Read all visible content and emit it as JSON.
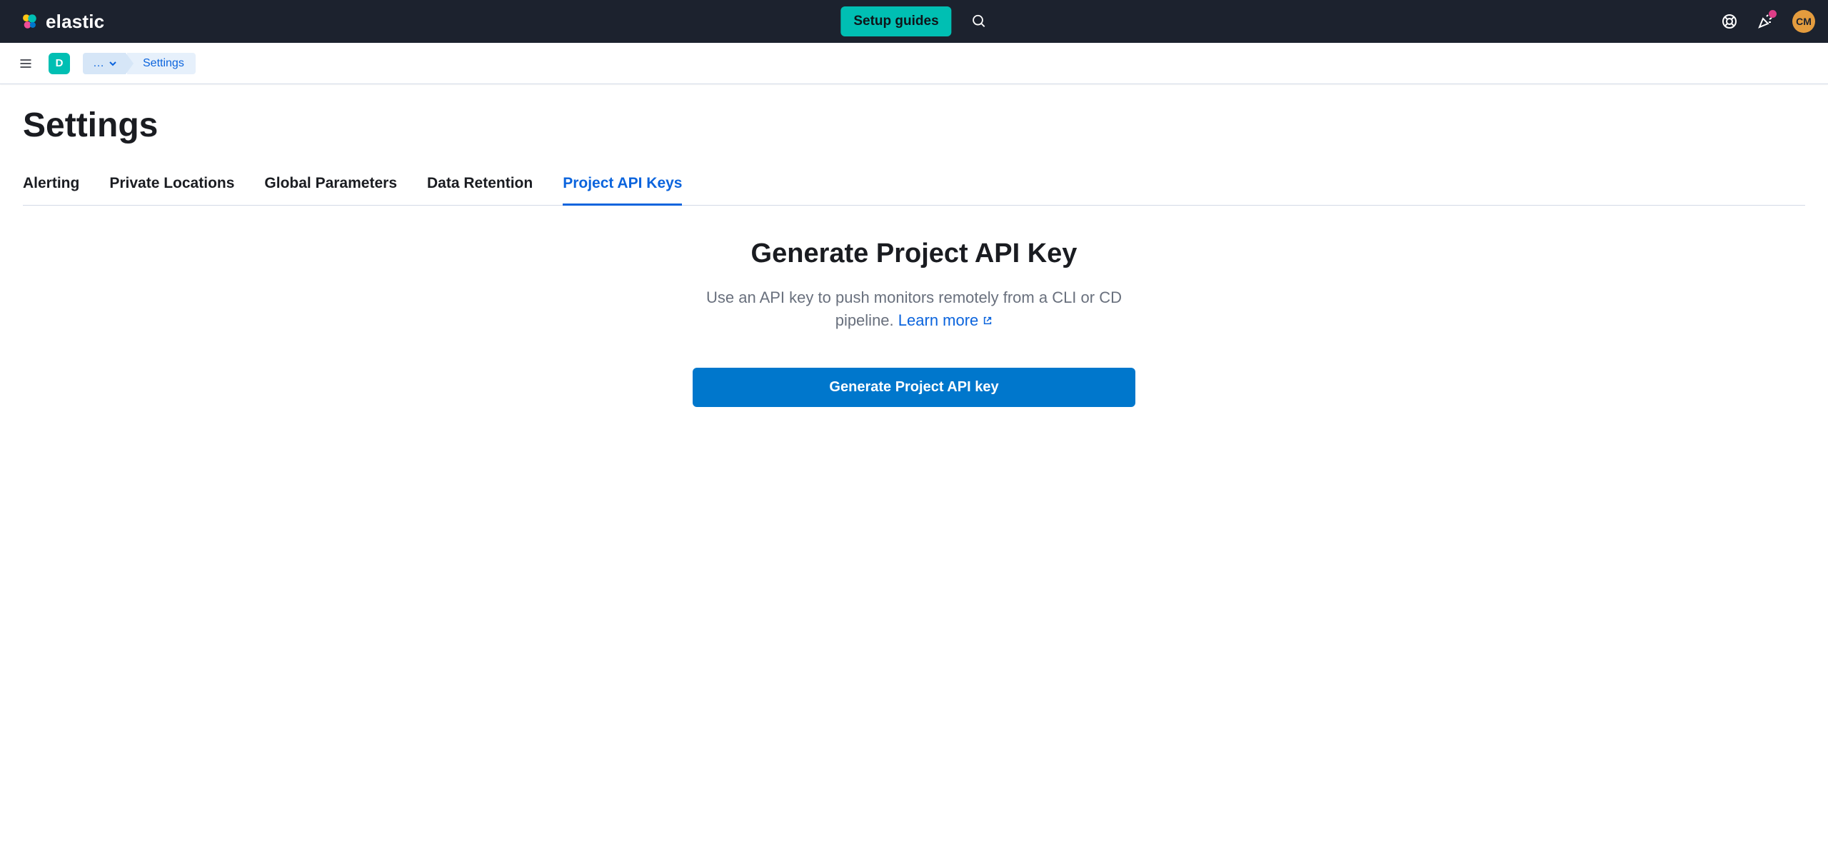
{
  "header": {
    "brand": "elastic",
    "setup_guides": "Setup guides",
    "avatar_initials": "CM"
  },
  "subheader": {
    "space_letter": "D",
    "collapsed_crumb": "…",
    "current_crumb": "Settings"
  },
  "page": {
    "title": "Settings",
    "tabs": [
      {
        "label": "Alerting"
      },
      {
        "label": "Private Locations"
      },
      {
        "label": "Global Parameters"
      },
      {
        "label": "Data Retention"
      },
      {
        "label": "Project API Keys"
      }
    ],
    "active_tab_index": 4
  },
  "panel": {
    "heading": "Generate Project API Key",
    "description_pre": "Use an API key to push monitors remotely from a CLI or CD pipeline. ",
    "learn_more": "Learn more",
    "generate_button": "Generate Project API key"
  }
}
